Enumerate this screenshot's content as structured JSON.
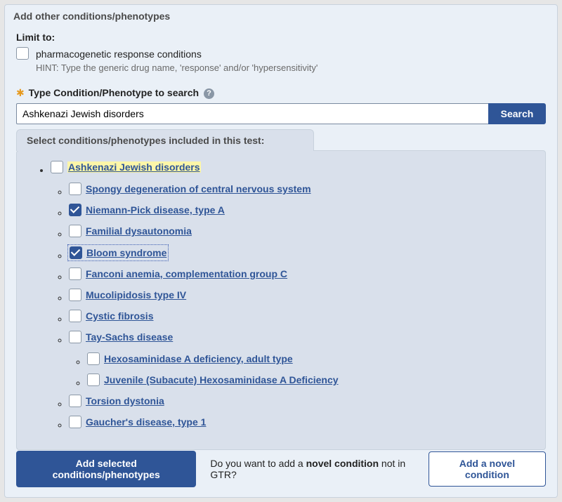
{
  "panel": {
    "title": "Add other conditions/phenotypes"
  },
  "limit": {
    "label": "Limit to:",
    "pharma_label": "pharmacogenetic response conditions",
    "hint": "HINT: Type the generic drug name, 'response' and/or 'hypersensitivity'",
    "pharma_checked": false
  },
  "search": {
    "label": "Type Condition/Phenotype to search",
    "value": "Ashkenazi Jewish disorders",
    "button": "Search",
    "help": "?"
  },
  "tree": {
    "tab_label": "Select conditions/phenotypes included in this test:",
    "root": {
      "label": "Ashkenazi Jewish disorders",
      "checked": false
    },
    "items": [
      {
        "label": "Spongy degeneration of central nervous system",
        "checked": false
      },
      {
        "label": "Niemann-Pick disease, type A",
        "checked": true
      },
      {
        "label": "Familial dysautonomia",
        "checked": false
      },
      {
        "label": "Bloom syndrome",
        "checked": true,
        "focused": true
      },
      {
        "label": "Fanconi anemia, complementation group C",
        "checked": false
      },
      {
        "label": "Mucolipidosis type IV",
        "checked": false
      },
      {
        "label": "Cystic fibrosis",
        "checked": false
      },
      {
        "label": "Tay-Sachs disease",
        "checked": false,
        "children": [
          {
            "label": "Hexosaminidase A deficiency, adult type",
            "checked": false
          },
          {
            "label": "Juvenile (Subacute) Hexosaminidase A Deficiency",
            "checked": false
          }
        ]
      },
      {
        "label": "Torsion dystonia",
        "checked": false
      },
      {
        "label": "Gaucher's disease, type 1",
        "checked": false
      }
    ]
  },
  "footer": {
    "add_selected": "Add selected conditions/phenotypes",
    "novel_prompt_pre": "Do you want to add a ",
    "novel_prompt_bold": "novel condition",
    "novel_prompt_post": " not in GTR?",
    "add_novel": "Add a novel condition"
  }
}
